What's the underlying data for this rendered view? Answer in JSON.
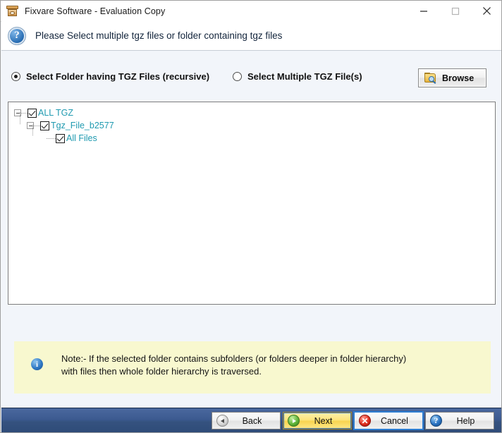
{
  "window": {
    "title": "Fixvare Software - Evaluation Copy",
    "app_icon": "archive-box-icon",
    "controls": {
      "minimize": "minimize-icon",
      "maximize": "maximize-icon",
      "close": "close-icon"
    }
  },
  "header": {
    "icon": "question-mark-icon",
    "icon_glyph": "?",
    "text": "Please Select multiple tgz files or folder containing tgz files"
  },
  "options": {
    "folder_radio": {
      "label": "Select Folder having TGZ Files (recursive)",
      "selected": true
    },
    "files_radio": {
      "label": "Select Multiple TGZ File(s)",
      "selected": false
    },
    "browse_button": {
      "label": "Browse",
      "icon": "folder-search-icon"
    }
  },
  "tree": {
    "nodes": [
      {
        "label": "ALL TGZ",
        "level": 1,
        "checked": true,
        "expanded": true
      },
      {
        "label": "Tgz_File_b2577",
        "level": 2,
        "checked": true,
        "expanded": true
      },
      {
        "label": "All Files",
        "level": 3,
        "checked": true,
        "expanded": false
      }
    ]
  },
  "note": {
    "icon": "info-icon",
    "icon_glyph": "i",
    "text": "Note:- If the selected folder contains subfolders (or folders deeper in folder hierarchy)\n with files then whole folder hierarchy is traversed."
  },
  "footer": {
    "buttons": [
      {
        "label": "Back",
        "icon": "rewind-icon",
        "glyph": ""
      },
      {
        "label": "Next",
        "icon": "play-icon",
        "glyph": ""
      },
      {
        "label": "Cancel",
        "icon": "cancel-icon",
        "glyph": "✕"
      },
      {
        "label": "Help",
        "icon": "question-icon",
        "glyph": "?"
      }
    ]
  },
  "colors": {
    "tree_text": "#1f9ab0",
    "note_bg": "#f8f8cf",
    "footer_bg": "#3c5a90",
    "next_accent": "#f9d450",
    "body_bg": "#f2f5fa"
  }
}
